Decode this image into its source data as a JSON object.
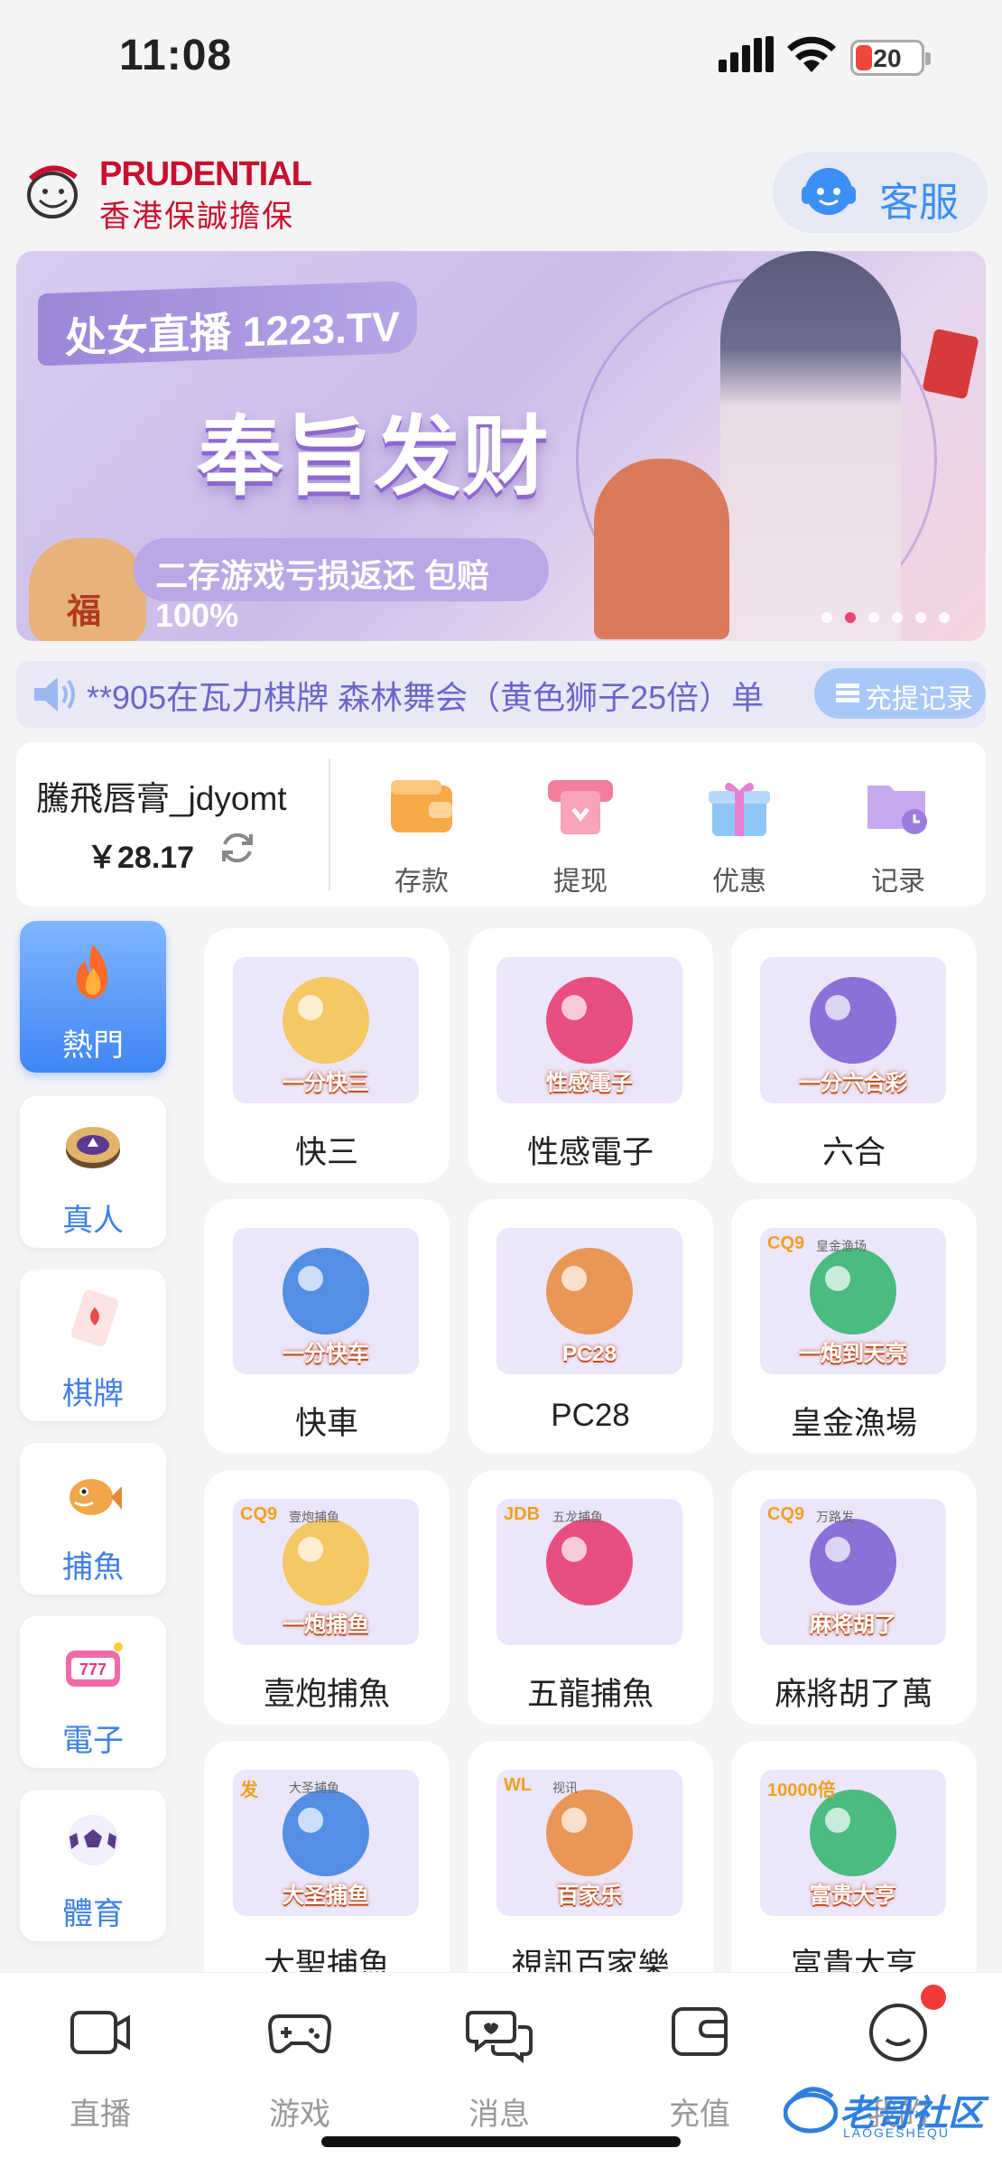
{
  "status_bar": {
    "time": "11:08",
    "battery_level": "20",
    "battery_color": "#f0463b"
  },
  "header": {
    "logo_en": "PRUDENTIAL",
    "logo_zh": "香港保誠擔保",
    "customer_service_label": "客服"
  },
  "banner": {
    "tag": "处女直播 1223.TV",
    "headline": "奉旨发财",
    "subline": "二存游戏亏损返还 包赔100%",
    "bag_char": "福",
    "active_slide": 1,
    "slide_count": 6
  },
  "notice": {
    "text": "**905在瓦力棋牌 森林舞会（黄色狮子25倍）单",
    "record_button": "充提记录"
  },
  "account": {
    "username": "騰飛唇膏_jdyomt",
    "balance": "￥28.17",
    "actions": [
      {
        "label": "存款",
        "icon": "wallet-icon"
      },
      {
        "label": "提现",
        "icon": "withdraw-icon"
      },
      {
        "label": "优惠",
        "icon": "gift-icon"
      },
      {
        "label": "记录",
        "icon": "folder-clock-icon"
      }
    ]
  },
  "categories": [
    {
      "label": "熱門",
      "icon": "flame-icon",
      "active": true
    },
    {
      "label": "真人",
      "icon": "casino-chip-icon",
      "active": false
    },
    {
      "label": "棋牌",
      "icon": "playing-card-icon",
      "active": false
    },
    {
      "label": "捕魚",
      "icon": "fish-icon",
      "active": false
    },
    {
      "label": "電子",
      "icon": "slot-machine-icon",
      "active": false
    },
    {
      "label": "體育",
      "icon": "soccer-ball-icon",
      "active": false
    }
  ],
  "games": [
    {
      "label": "快三",
      "thumb_text": "一分快三",
      "icon": "dice-icon"
    },
    {
      "label": "性感電子",
      "thumb_text": "性感電子",
      "icon": "sexy-slots-icon"
    },
    {
      "label": "六合",
      "thumb_text": "一分六合彩",
      "icon": "lottery-balls-icon"
    },
    {
      "label": "快車",
      "thumb_text": "一分快车",
      "icon": "jeep-icon"
    },
    {
      "label": "PC28",
      "thumb_text": "PC28",
      "icon": "billiard-ball-icon"
    },
    {
      "label": "皇金漁場",
      "thumb_text": "一炮到天亮",
      "brand": "CQ9",
      "brand_sub": "皇金渔场",
      "icon": "golden-fish-icon"
    },
    {
      "label": "壹炮捕魚",
      "thumb_text": "一炮捕鱼",
      "brand": "CQ9",
      "brand_sub": "壹炮捕鱼",
      "icon": "dragon-fish-icon"
    },
    {
      "label": "五龍捕魚",
      "thumb_text": "",
      "brand": "JDB",
      "brand_sub": "五龙捕鱼",
      "icon": "shark-icon"
    },
    {
      "label": "麻將胡了萬",
      "thumb_text": "麻将胡了",
      "brand": "CQ9",
      "brand_sub": "万路发",
      "icon": "mahjong-icon"
    },
    {
      "label": "大聖捕魚",
      "thumb_text": "大圣捕鱼",
      "brand": "发",
      "brand_sub": "大圣捕鱼",
      "icon": "monkey-king-icon"
    },
    {
      "label": "視訊百家樂",
      "thumb_text": "百家乐",
      "brand": "WL",
      "brand_sub": "视讯",
      "icon": "tv-play-icon"
    },
    {
      "label": "富貴大亨",
      "thumb_text": "富贵大亨",
      "brand": "10000倍",
      "brand_sub": "",
      "icon": "tycoon-icon"
    }
  ],
  "tabbar": [
    {
      "label": "直播",
      "icon": "video-camera-icon"
    },
    {
      "label": "游戏",
      "icon": "gamepad-icon"
    },
    {
      "label": "消息",
      "icon": "chat-bubbles-icon"
    },
    {
      "label": "充值",
      "icon": "wallet-outline-icon"
    },
    {
      "label": "我的",
      "icon": "smiley-face-icon"
    }
  ],
  "watermark": {
    "title": "老哥社区",
    "sub": "LAOGESHEQU"
  },
  "colors": {
    "accent": "#3f86f4",
    "banner_dot_active": "#e8336a",
    "notice_text": "#6b66c9",
    "badge": "#f23a3a"
  }
}
